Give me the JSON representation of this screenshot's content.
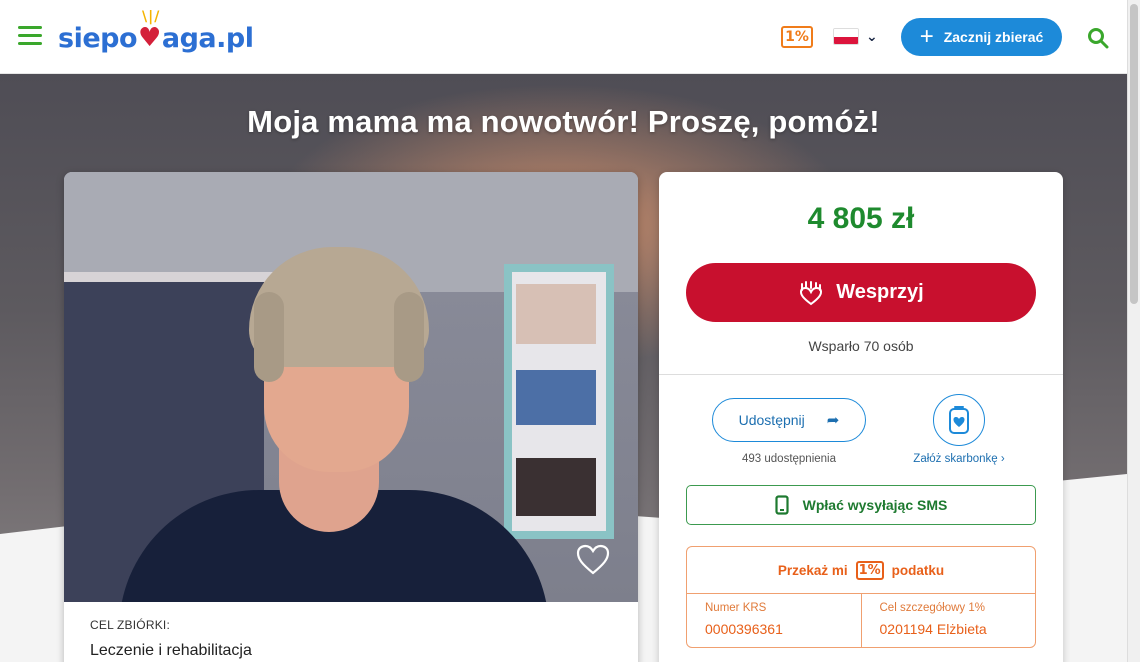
{
  "header": {
    "logo_parts": [
      "sie",
      "po",
      "aga.pl"
    ],
    "one_percent": "1%",
    "start_label": "Zacznij zbierać"
  },
  "hero": {
    "title": "Moja mama ma nowotwór! Proszę, pomóż!"
  },
  "goal": {
    "label": "CEL ZBIÓRKI:",
    "value": "Leczenie i rehabilitacja"
  },
  "donation": {
    "amount": "4 805 zł",
    "support_label": "Wesprzyj",
    "supporters": "Wsparło 70 osób",
    "share_label": "Udostępnij",
    "shares_count": "493 udostępnienia",
    "piggy_link": "Załóż skarbonkę ›",
    "sms_label": "Wpłać wysyłając SMS"
  },
  "tax": {
    "head_before": "Przekaż mi",
    "head_pct": "1%",
    "head_after": "podatku",
    "krs_label": "Numer KRS",
    "krs_value": "0000396361",
    "goal_label": "Cel szczegółowy 1%",
    "goal_value": "0201194 Elżbieta"
  },
  "colors": {
    "brand_green": "#3aa72c",
    "brand_blue": "#1d8ad9",
    "support_red": "#c8102e",
    "amount_green": "#1e8a2e",
    "tax_orange": "#e8601a"
  },
  "icons": [
    "menu-icon",
    "one-percent-icon",
    "poland-flag-icon",
    "chevron-down-icon",
    "plus-icon",
    "search-icon",
    "heart-icon",
    "hand-heart-icon",
    "share-arrow-icon",
    "piggy-bank-icon",
    "phone-icon"
  ]
}
